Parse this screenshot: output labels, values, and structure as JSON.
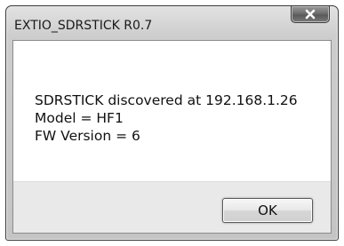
{
  "window": {
    "title": "EXTIO_SDRSTICK R0.7",
    "close_icon": "close-icon"
  },
  "message": {
    "line1": "SDRSTICK discovered at 192.168.1.26",
    "line2": "Model = HF1",
    "line3": "FW Version = 6"
  },
  "buttons": {
    "ok_label": "OK"
  }
}
